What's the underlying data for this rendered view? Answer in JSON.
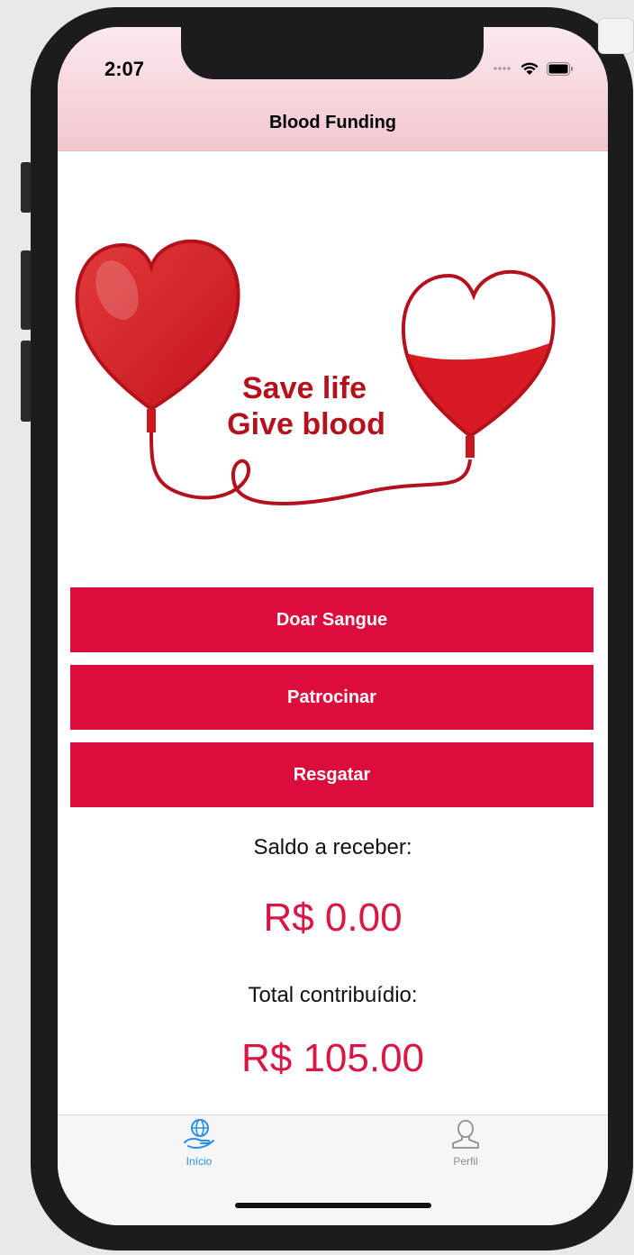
{
  "status_bar": {
    "time": "2:07",
    "icons": [
      "signal-icon",
      "wifi-icon",
      "battery-icon"
    ]
  },
  "nav": {
    "title": "Blood Funding"
  },
  "hero": {
    "line1": "Save life",
    "line2": "Give blood",
    "fill_level": 0.55
  },
  "actions": {
    "donate": "Doar Sangue",
    "sponsor": "Patrocinar",
    "redeem": "Resgatar"
  },
  "balance": {
    "label": "Saldo a receber:",
    "value": "R$ 0.00"
  },
  "contribution": {
    "label": "Total contribuídio:",
    "value": "R$ 105.00"
  },
  "tabs": [
    {
      "label": "Início",
      "icon": "globe-hand-icon",
      "active": true
    },
    {
      "label": "Perfil",
      "icon": "person-icon",
      "active": false
    }
  ],
  "colors": {
    "accent": "#dc0d3c",
    "value_text": "#d91744",
    "tab_active": "#2b8fe8",
    "tab_inactive": "#8e8e93"
  }
}
